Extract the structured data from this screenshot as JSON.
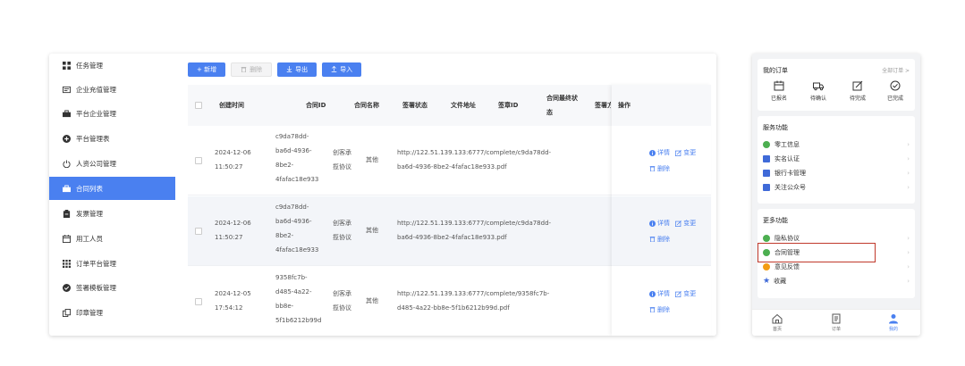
{
  "admin": {
    "sidebar": {
      "items": [
        {
          "label": "任务管理",
          "icon": "grid-icon",
          "active": false
        },
        {
          "label": "企业充值管理",
          "icon": "wallet-icon",
          "active": false
        },
        {
          "label": "平台企业管理",
          "icon": "briefcase-icon",
          "active": false
        },
        {
          "label": "平台管理表",
          "icon": "plus-circle-icon",
          "active": false
        },
        {
          "label": "人资公司管理",
          "icon": "power-icon",
          "active": false
        },
        {
          "label": "合同列表",
          "icon": "briefcase-icon",
          "active": true
        },
        {
          "label": "发票管理",
          "icon": "clipboard-icon",
          "active": false
        },
        {
          "label": "用工人员",
          "icon": "calendar-icon",
          "active": false
        },
        {
          "label": "订单平台管理",
          "icon": "grid-icon",
          "active": false
        },
        {
          "label": "签署模板管理",
          "icon": "check-circle-icon",
          "active": false
        },
        {
          "label": "印章管理",
          "icon": "copy-icon",
          "active": false
        }
      ]
    },
    "toolbar": {
      "add_label": "+ 新增",
      "delete_label": "删除",
      "export_label": "导出",
      "import_label": "导入"
    },
    "table": {
      "headers": {
        "created_time": "创建时间",
        "contract_id": "合同ID",
        "contract_name": "合同名称",
        "sign_status": "签署状态",
        "file_address": "文件地址",
        "sign_id": "签章ID",
        "final_status_1": "合同最终状",
        "final_status_2": "态",
        "signer": "签署方",
        "operations": "操作"
      },
      "rows": [
        {
          "date": "2024-12-06",
          "time": "11:50:27",
          "id_lines": [
            "c9da78dd-",
            "ba6d-4936-",
            "8be2-",
            "4fafac18e933"
          ],
          "name_lines": [
            "创客承",
            "揽协议"
          ],
          "status": "其他",
          "url_lines": [
            "http://122.51.139.133:6777/complete/c9da78dd-",
            "ba6d-4936-8be2-4fafac18e933.pdf"
          ],
          "detail": "详情",
          "change": "变更",
          "delete": "删除"
        },
        {
          "date": "2024-12-06",
          "time": "11:50:27",
          "id_lines": [
            "c9da78dd-",
            "ba6d-4936-",
            "8be2-",
            "4fafac18e933"
          ],
          "name_lines": [
            "创客承",
            "揽协议"
          ],
          "status": "其他",
          "url_lines": [
            "http://122.51.139.133:6777/complete/c9da78dd-",
            "ba6d-4936-8be2-4fafac18e933.pdf"
          ],
          "detail": "详情",
          "change": "变更",
          "delete": "删除"
        },
        {
          "date": "2024-12-05",
          "time": "17:54:12",
          "id_lines": [
            "9358fc7b-",
            "d485-4a22-",
            "bb8e-",
            "5f1b6212b99d"
          ],
          "name_lines": [
            "创客承",
            "揽协议"
          ],
          "status": "其他",
          "url_lines": [
            "http://122.51.139.133:6777/complete/9358fc7b-",
            "d485-4a22-bb8e-5f1b6212b99d.pdf"
          ],
          "detail": "详情",
          "change": "变更",
          "delete": "删除"
        }
      ]
    }
  },
  "mobile": {
    "orders": {
      "title": "我的订单",
      "all_link": "全部订单 >",
      "items": [
        {
          "label": "已报名",
          "icon": "calendar-icon"
        },
        {
          "label": "待确认",
          "icon": "truck-icon"
        },
        {
          "label": "待完成",
          "icon": "edit-icon"
        },
        {
          "label": "已完成",
          "icon": "check-circle-icon"
        }
      ]
    },
    "services": {
      "title": "服务功能",
      "items": [
        {
          "label": "零工信息",
          "icon": "user-icon",
          "color": "#4caf50"
        },
        {
          "label": "实名认证",
          "icon": "id-card-icon",
          "color": "#3f6ad8"
        },
        {
          "label": "银行卡管理",
          "icon": "bank-card-icon",
          "color": "#3f6ad8"
        },
        {
          "label": "关注公众号",
          "icon": "key-icon",
          "color": "#3f6ad8"
        }
      ]
    },
    "more": {
      "title": "更多功能",
      "items": [
        {
          "label": "隐私协议",
          "icon": "shield-icon",
          "color": "#4caf50"
        },
        {
          "label": "合同管理",
          "icon": "document-icon",
          "color": "#4caf50"
        },
        {
          "label": "意见反馈",
          "icon": "feedback-icon",
          "color": "#f39c12"
        },
        {
          "label": "收藏",
          "icon": "star-icon",
          "color": "#3f6ad8"
        }
      ]
    },
    "tabbar": {
      "items": [
        {
          "label": "首页",
          "icon": "home-icon",
          "active": false
        },
        {
          "label": "订单",
          "icon": "receipt-icon",
          "active": false
        },
        {
          "label": "我的",
          "icon": "user-icon",
          "active": true
        }
      ]
    }
  },
  "colors": {
    "primary": "#4a80f0",
    "highlight_border": "#c0392b"
  }
}
